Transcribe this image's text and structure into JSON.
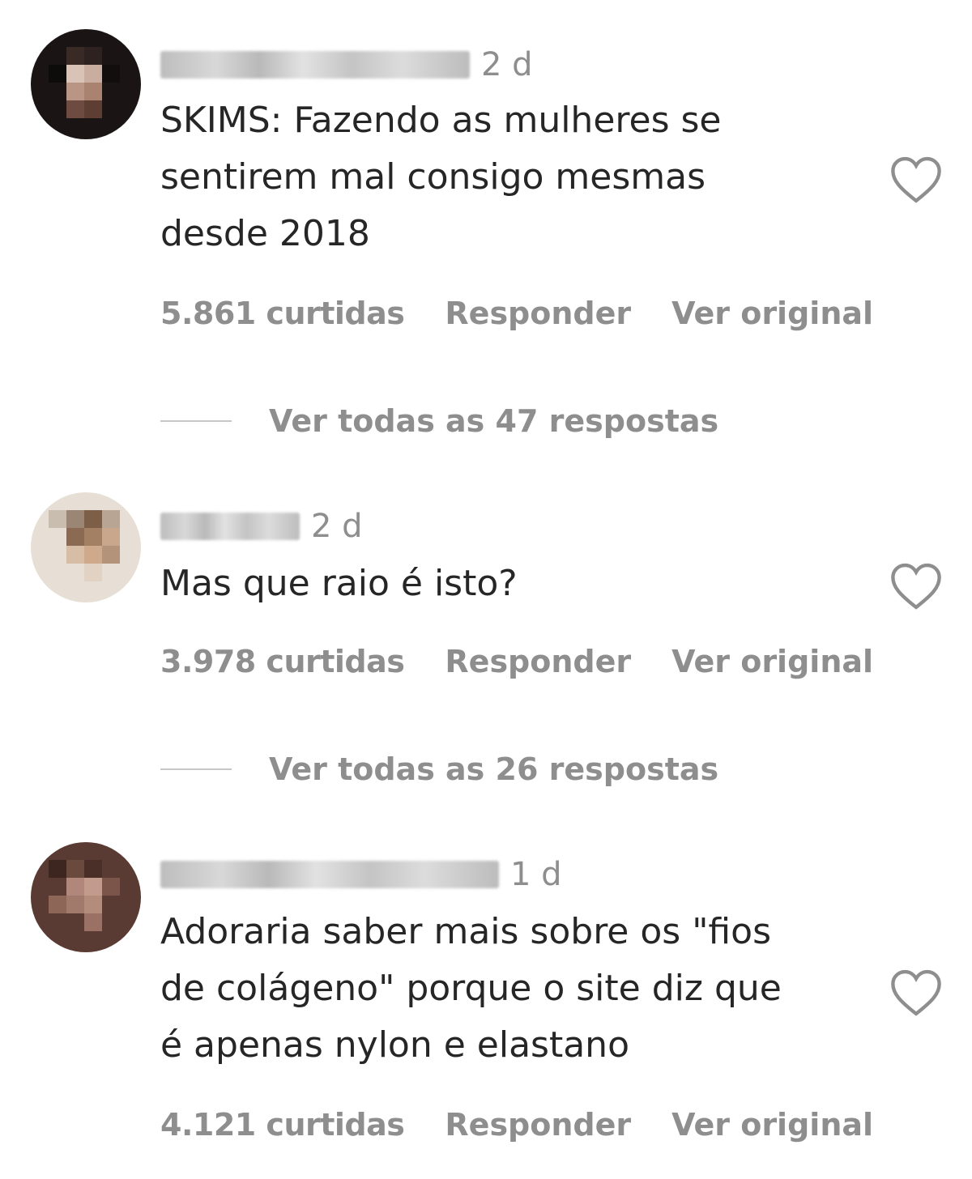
{
  "comments": [
    {
      "time": "2 d",
      "text": "SKIMS: Fazendo as mulheres se\nsentirem mal consigo mesmas\ndesde 2018",
      "likes": "5.861 curtidas",
      "reply_label": "Responder",
      "translate_label": "Ver original",
      "view_replies": "Ver todas as 47 respostas",
      "like_icon": "heart-outline-icon"
    },
    {
      "time": "2 d",
      "text": "Mas que raio é isto?",
      "likes": "3.978 curtidas",
      "reply_label": "Responder",
      "translate_label": "Ver original",
      "view_replies": "Ver todas as 26 respostas",
      "like_icon": "heart-outline-icon"
    },
    {
      "time": "1 d",
      "text": "Adoraria saber mais sobre os \"fios\nde colágeno\" porque o site diz que\né apenas nylon e elastano",
      "likes": "4.121 curtidas",
      "reply_label": "Responder",
      "translate_label": "Ver original",
      "like_icon": "heart-outline-icon"
    }
  ],
  "colors": {
    "text": "#262626",
    "secondary": "#8e8e8e",
    "divider": "#c7c7c7",
    "background": "#ffffff"
  }
}
